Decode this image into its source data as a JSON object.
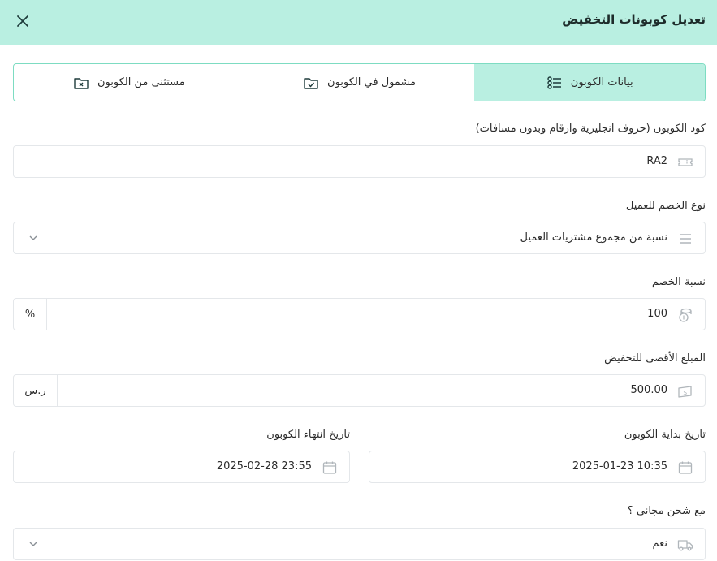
{
  "header": {
    "title": "تعديل كوبونات التخفيض",
    "close_icon": "close-icon"
  },
  "tabs": [
    {
      "label": "بيانات الكوبون",
      "icon": "list-icon",
      "active": true
    },
    {
      "label": "مشمول في الكوبون",
      "icon": "folder-check-icon",
      "active": false
    },
    {
      "label": "مستثنى من الكوبون",
      "icon": "folder-x-icon",
      "active": false
    }
  ],
  "form": {
    "coupon_code": {
      "label": "كود الكوبون (حروف انجليزية وارقام وبدون مسافات)",
      "value": "RA2",
      "icon": "ticket-icon"
    },
    "discount_type": {
      "label": "نوع الخصم للعميل",
      "value": "نسبة من مجموع مشتريات العميل",
      "icon": "menu-icon"
    },
    "discount_rate": {
      "label": "نسبة الخصم",
      "value": "100",
      "suffix": "%",
      "icon": "coins-icon"
    },
    "max_amount": {
      "label": "المبلغ الأقصى للتخفيض",
      "value": "500.00",
      "suffix": "ر.س",
      "icon": "money-icon"
    },
    "start_date": {
      "label": "تاريخ بداية الكوبون",
      "value": "2025-01-23 10:35",
      "icon": "calendar-icon"
    },
    "end_date": {
      "label": "تاريخ انتهاء الكوبون",
      "value": "2025-02-28 23:55",
      "icon": "calendar-icon"
    },
    "free_shipping": {
      "label": "مع شحن مجاني ؟",
      "value": "نعم",
      "icon": "truck-icon"
    }
  },
  "colors": {
    "accent": "#b9efe1",
    "border_accent": "#7ddcc2",
    "border": "#e4e7ea",
    "icon": "#b0b6bb"
  }
}
